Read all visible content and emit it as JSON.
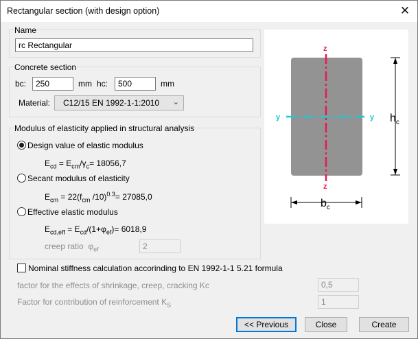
{
  "window": {
    "title": "Rectangular section (with design option)"
  },
  "name_group": {
    "legend": "Name",
    "value": "rc Rectangular"
  },
  "concrete_group": {
    "legend": "Concrete section",
    "bc_label": "bc:",
    "bc_value": "250",
    "bc_unit": "mm",
    "hc_label": "hc:",
    "hc_value": "500",
    "hc_unit": "mm",
    "material_label": "Material:",
    "material_value": "C12/15 EN 1992-1-1:2010"
  },
  "modulus_group": {
    "legend": "Modulus of elasticity applied in structural analysis",
    "options": [
      {
        "label": "Design value of elastic modulus",
        "selected": true
      },
      {
        "label": "Secant modulus of elasticity",
        "selected": false
      },
      {
        "label": "Effective elastic modulus",
        "selected": false
      }
    ],
    "formulas": {
      "design_value": "18056,7",
      "secant_value": "27085,0",
      "effective_value": "6018,9"
    },
    "creep_label": "creep ratio",
    "creep_value": "2"
  },
  "nominal": {
    "checkbox_label": "Nominal stiffness calculation accorinding to EN 1992-1-1 5.21 formula",
    "checked": false,
    "kc_label": "factor for the effects of shrinkage, creep, cracking Kc",
    "kc_value": "0,5",
    "ks_label": "Factor for contribution of reinforcement K",
    "ks_value": "1"
  },
  "figure": {
    "axis_z_top": "z",
    "axis_z_bottom": "z",
    "axis_y_left": "y",
    "axis_y_right": "y",
    "dim_h": "h",
    "dim_h_sub": "c",
    "dim_b": "b",
    "dim_b_sub": "c",
    "section_color": "#939393",
    "z_axis_color": "#e8194f",
    "y_axis_color": "#1bc9d6"
  },
  "buttons": {
    "previous": "<< Previous",
    "close": "Close",
    "create": "Create"
  },
  "icons": {
    "close": "close-icon",
    "dropdown": "chevron-down-icon"
  }
}
